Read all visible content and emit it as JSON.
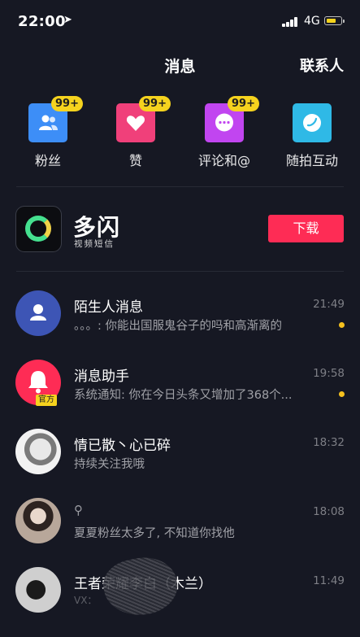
{
  "status_bar": {
    "time": "22:00",
    "network": "4G"
  },
  "header": {
    "title": "消息",
    "contacts_link": "联系人"
  },
  "categories": [
    {
      "label": "粉丝",
      "badge": "99+",
      "icon": "users-icon",
      "color": "#3d8ef7"
    },
    {
      "label": "赞",
      "badge": "99+",
      "icon": "heart-icon",
      "color": "#f0407a"
    },
    {
      "label": "评论和@",
      "badge": "99+",
      "icon": "comment-icon",
      "color": "#c145f0"
    },
    {
      "label": "随拍互动",
      "badge": "",
      "icon": "camera-interaction-icon",
      "color": "#2fb9e6"
    }
  ],
  "promo": {
    "app_name": "多闪",
    "app_subtitle": "视频短信",
    "button_label": "下载"
  },
  "messages": [
    {
      "name": "陌生人消息",
      "preview": "。。。: 你能出国服鬼谷子的吗和高渐离的",
      "time": "21:49",
      "unread": true
    },
    {
      "name": "消息助手",
      "preview": "系统通知: 你在今日头条又增加了368个...",
      "time": "19:58",
      "unread": true,
      "tag": "官方"
    },
    {
      "name": "情已散丶心已碎",
      "preview": "持续关注我哦",
      "time": "18:32",
      "unread": false
    },
    {
      "name": "",
      "preview": "夏夏粉丝太多了, 不知道你找他",
      "time": "18:08",
      "unread": false
    },
    {
      "name": "王者荣耀李白（木兰）",
      "preview": "VX：",
      "time": "11:49",
      "unread": false
    }
  ],
  "colors": {
    "background": "#161823",
    "accent": "#fe2c55",
    "badge": "#f6d31e"
  }
}
